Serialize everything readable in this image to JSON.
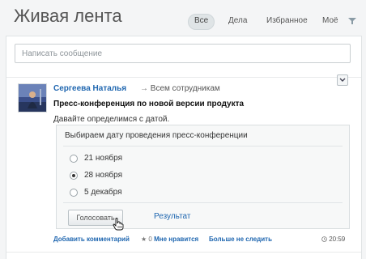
{
  "header": {
    "title": "Живая лента",
    "tabs": [
      {
        "label": "Все",
        "active": true
      },
      {
        "label": "Дела",
        "active": false
      },
      {
        "label": "Избранное",
        "active": false
      },
      {
        "label": "Моё",
        "active": false
      }
    ]
  },
  "composer": {
    "placeholder": "Написать сообщение"
  },
  "post": {
    "author": "Сергеева Наталья",
    "recipients": "Всем сотрудникам",
    "title": "Пресс-конференция по новой версии продукта",
    "text": "Давайте определимся с датой.",
    "poll": {
      "question": "Выбираем дату проведения пресс-конференции",
      "options": [
        {
          "label": "21 ноября",
          "selected": false
        },
        {
          "label": "28 ноября",
          "selected": true
        },
        {
          "label": "5 декабря",
          "selected": false
        }
      ],
      "vote_label": "Голосовать",
      "results_label": "Результат"
    },
    "footer": {
      "comment_label": "Добавить комментарий",
      "likes_count": "0",
      "like_label": "Мне нравится",
      "unfollow_label": "Больше не следить",
      "time": "20:59"
    }
  },
  "colors": {
    "link": "#2067b0",
    "background": "#f4f5f6"
  }
}
